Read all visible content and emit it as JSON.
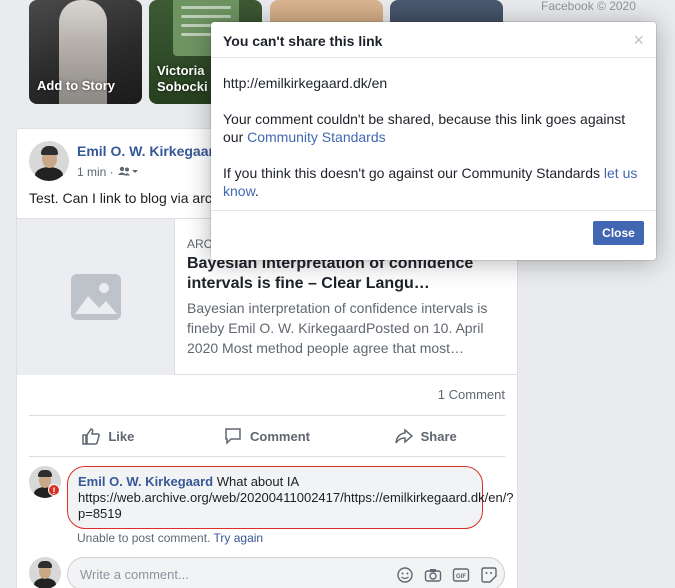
{
  "stories": [
    {
      "label": "Add to Story"
    },
    {
      "label_line1": "Victoria",
      "label_line2": "Sobocki"
    },
    {
      "label": ""
    },
    {
      "label": ""
    }
  ],
  "footer": {
    "copyright": "Facebook © 2020"
  },
  "post": {
    "author": "Emil O. W. Kirkegaard",
    "time": "1 min ·",
    "audience_icon": "friends-icon",
    "text": "Test. Can I link to blog via arc",
    "link_preview": {
      "domain": "ARC",
      "title": "Bayesian interpretation of confidence intervals is fine – Clear Langu…",
      "description": "Bayesian interpretation of confidence intervals is fineby Emil O. W. KirkegaardPosted on 10. April 2020 Most method people agree that most…"
    },
    "comment_count": "1 Comment",
    "actions": {
      "like": "Like",
      "comment": "Comment",
      "share": "Share"
    },
    "comment": {
      "author": "Emil O. W. Kirkegaard",
      "text": "What about IA https://web.archive.org/web/20200411002417/https://emilkirkegaard.dk/en/?p=8519",
      "status": "Unable to post comment.",
      "retry": "Try again"
    },
    "write_placeholder": "Write a comment..."
  },
  "dialog": {
    "title": "You can't share this link",
    "url": "http://emilkirkegaard.dk/en",
    "message_part1": "Your comment couldn't be shared, because this link goes against our",
    "message_link": "Community Standards",
    "message_part3": "If you think this doesn't go against our Community Standards",
    "message_link2": "let us know",
    "message_end": ".",
    "close_label": "Close",
    "close_x": "×"
  },
  "colors": {
    "brand": "#4267b2",
    "link": "#365899",
    "error": "#d93025"
  }
}
